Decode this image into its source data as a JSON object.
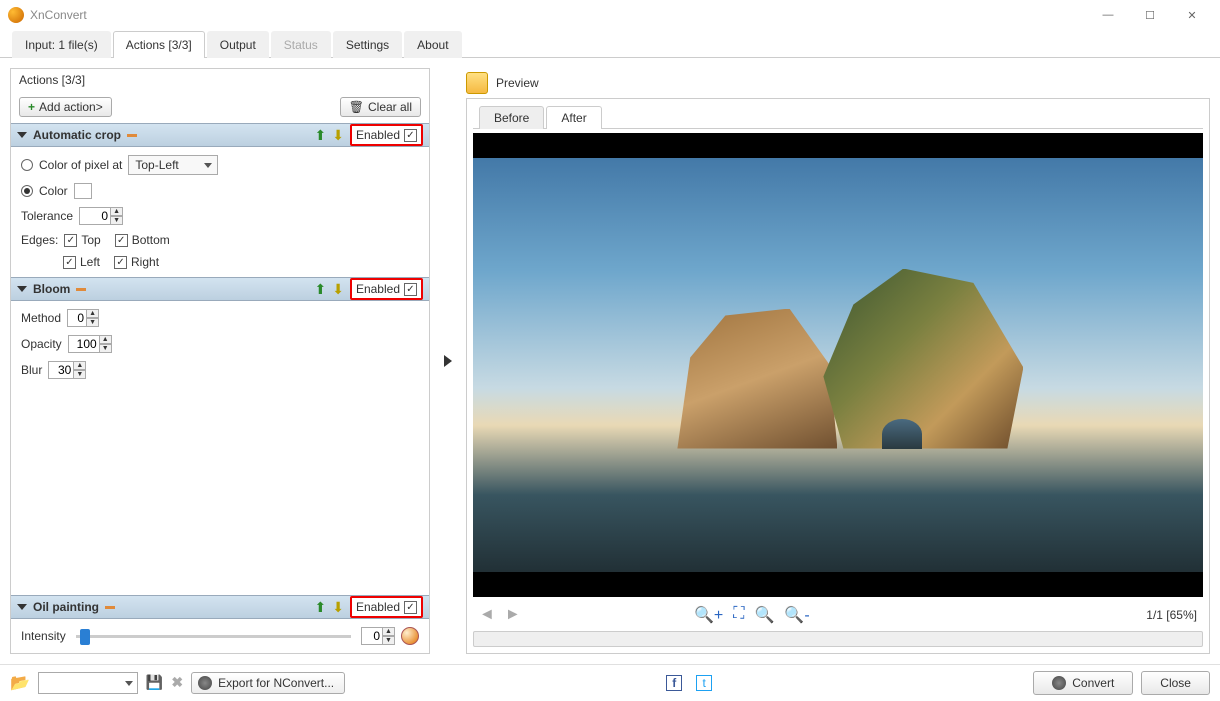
{
  "window": {
    "title": "XnConvert"
  },
  "tabs": {
    "input": "Input: 1 file(s)",
    "actions": "Actions [3/3]",
    "output": "Output",
    "status": "Status",
    "settings": "Settings",
    "about": "About"
  },
  "actions_panel": {
    "title": "Actions [3/3]",
    "add_action": "Add action>",
    "clear_all": "Clear all",
    "enabled_label": "Enabled",
    "crop": {
      "name": "Automatic crop",
      "color_pixel_at": "Color of pixel at",
      "position": "Top-Left",
      "color": "Color",
      "tolerance_label": "Tolerance",
      "tolerance": "0",
      "edges_label": "Edges:",
      "top": "Top",
      "bottom": "Bottom",
      "left": "Left",
      "right": "Right"
    },
    "bloom": {
      "name": "Bloom",
      "method_label": "Method",
      "method": "0",
      "opacity_label": "Opacity",
      "opacity": "100",
      "blur_label": "Blur",
      "blur": "30"
    },
    "oil": {
      "name": "Oil painting",
      "intensity_label": "Intensity",
      "intensity": "0"
    }
  },
  "preview": {
    "title": "Preview",
    "before": "Before",
    "after": "After",
    "count": "1/1 [65%]"
  },
  "footer": {
    "export": "Export for NConvert...",
    "convert": "Convert",
    "close": "Close"
  }
}
